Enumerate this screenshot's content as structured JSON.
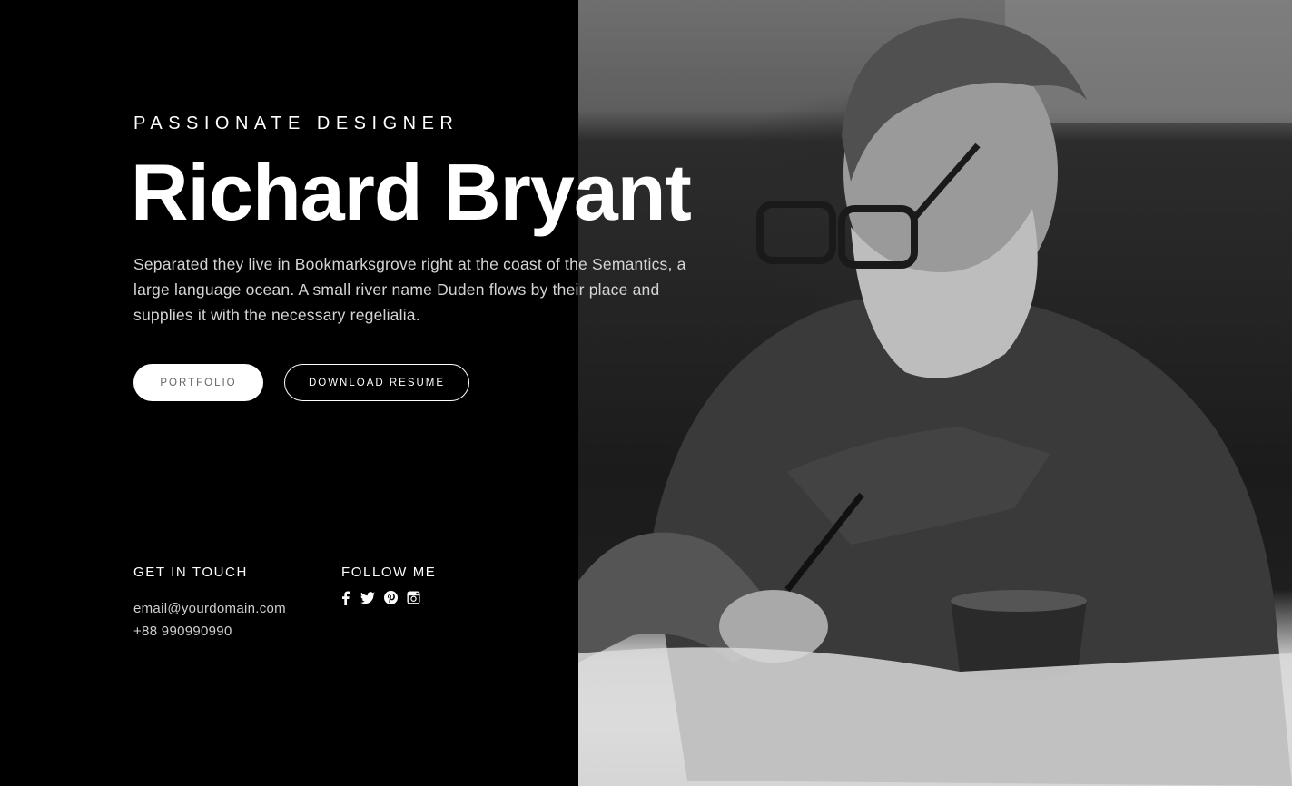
{
  "hero": {
    "tagline": "PASSIONATE DESIGNER",
    "name": "Richard Bryant",
    "bio": "Separated they live in Bookmarksgrove right at the coast of the Semantics, a large language ocean. A small river name Duden flows by their place and supplies it with the necessary regelialia.",
    "buttons": {
      "portfolio": "PORTFOLIO",
      "resume": "DOWNLOAD RESUME"
    }
  },
  "contact": {
    "heading": "GET IN TOUCH",
    "email": "email@yourdomain.com",
    "phone": "+88 990990990"
  },
  "follow": {
    "heading": "FOLLOW ME",
    "icons": [
      "facebook-icon",
      "twitter-icon",
      "pinterest-icon",
      "instagram-icon"
    ]
  },
  "theme": {
    "background": "#000000",
    "text": "#ffffff",
    "muted_text": "#d4d4d4"
  },
  "photo": {
    "subject": "bearded man with glasses sketching at a table (black and white)"
  }
}
